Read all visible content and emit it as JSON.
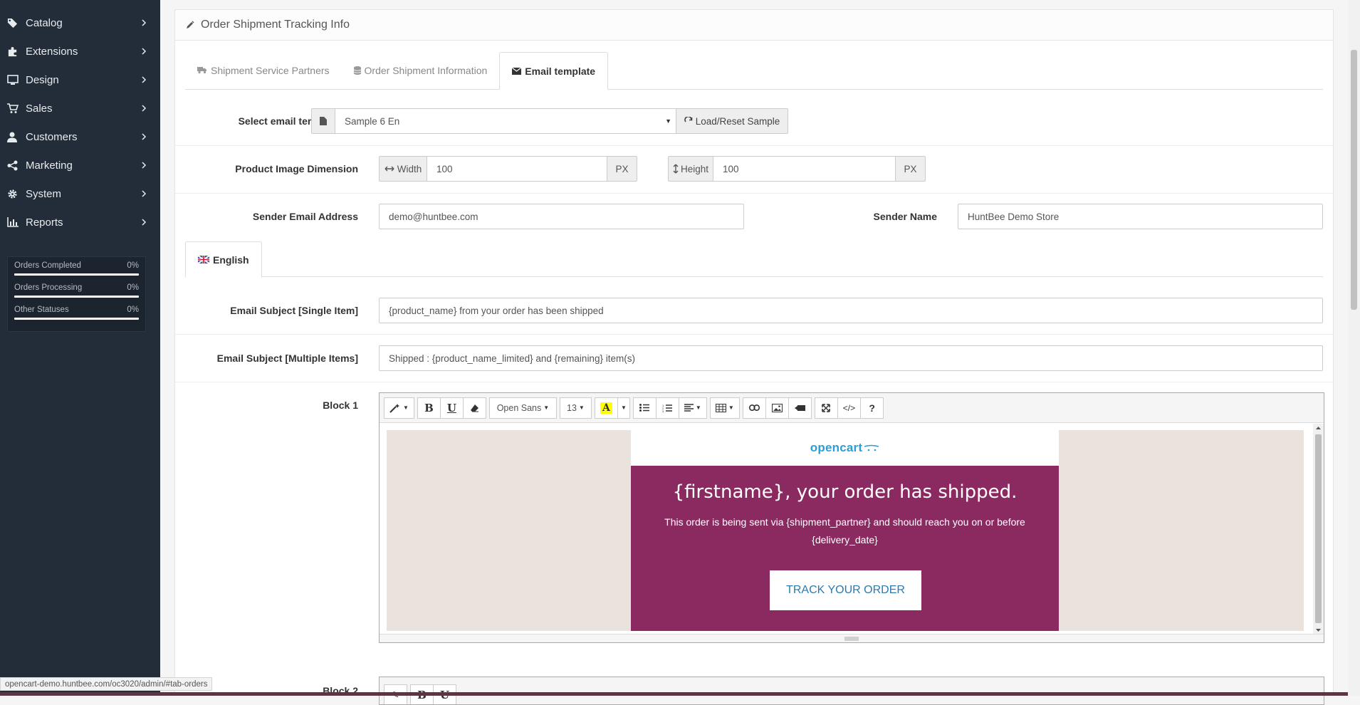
{
  "sidebar": {
    "items": [
      {
        "label": "Catalog",
        "icon": "tag-icon"
      },
      {
        "label": "Extensions",
        "icon": "puzzle-icon"
      },
      {
        "label": "Design",
        "icon": "monitor-icon"
      },
      {
        "label": "Sales",
        "icon": "cart-icon"
      },
      {
        "label": "Customers",
        "icon": "user-icon"
      },
      {
        "label": "Marketing",
        "icon": "share-icon"
      },
      {
        "label": "System",
        "icon": "gear-icon"
      },
      {
        "label": "Reports",
        "icon": "bar-chart-icon"
      }
    ],
    "stats": [
      {
        "label": "Orders Completed",
        "value": "0%"
      },
      {
        "label": "Orders Processing",
        "value": "0%"
      },
      {
        "label": "Other Statuses",
        "value": "0%"
      }
    ]
  },
  "panel": {
    "title": "Order Shipment Tracking Info",
    "tabs": [
      {
        "label": "Shipment Service Partners"
      },
      {
        "label": "Order Shipment Information"
      },
      {
        "label": "Email template"
      }
    ]
  },
  "form": {
    "select_template_label": "Select email template",
    "select_template_value": "Sample 6 En",
    "load_reset_label": "Load/Reset Sample",
    "image_dimension_label": "Product Image Dimension",
    "width_label": "Width",
    "width_value": "100",
    "height_label": "Height",
    "height_value": "100",
    "px_unit": "PX",
    "sender_email_label": "Sender Email Address",
    "sender_email_value": "demo@huntbee.com",
    "sender_name_label": "Sender Name",
    "sender_name_value": "HuntBee Demo Store",
    "language_tab": "English",
    "subject_single_label": "Email Subject [Single Item]",
    "subject_single_value": "{product_name} from your order has been shipped",
    "subject_multi_label": "Email Subject [Multiple Items]",
    "subject_multi_value": "Shipped : {product_name_limited} and {remaining} item(s)",
    "block1_label": "Block 1",
    "block2_label": "Block 2"
  },
  "editor": {
    "font_name": "Open Sans",
    "font_size": "13",
    "logo_text": "opencart",
    "email_title": "{firstname}, your order has shipped.",
    "email_body": "This order is being sent via {shipment_partner} and should reach you on or before {delivery_date}",
    "track_button": "TRACK YOUR ORDER"
  },
  "status_url": "opencart-demo.huntbee.com/oc3020/admin/#tab-orders",
  "colors": {
    "sidebar_bg": "#232c39",
    "email_accent": "#8b2a60",
    "email_bg": "#e9e2dd",
    "link_blue": "#2a7ab0"
  }
}
